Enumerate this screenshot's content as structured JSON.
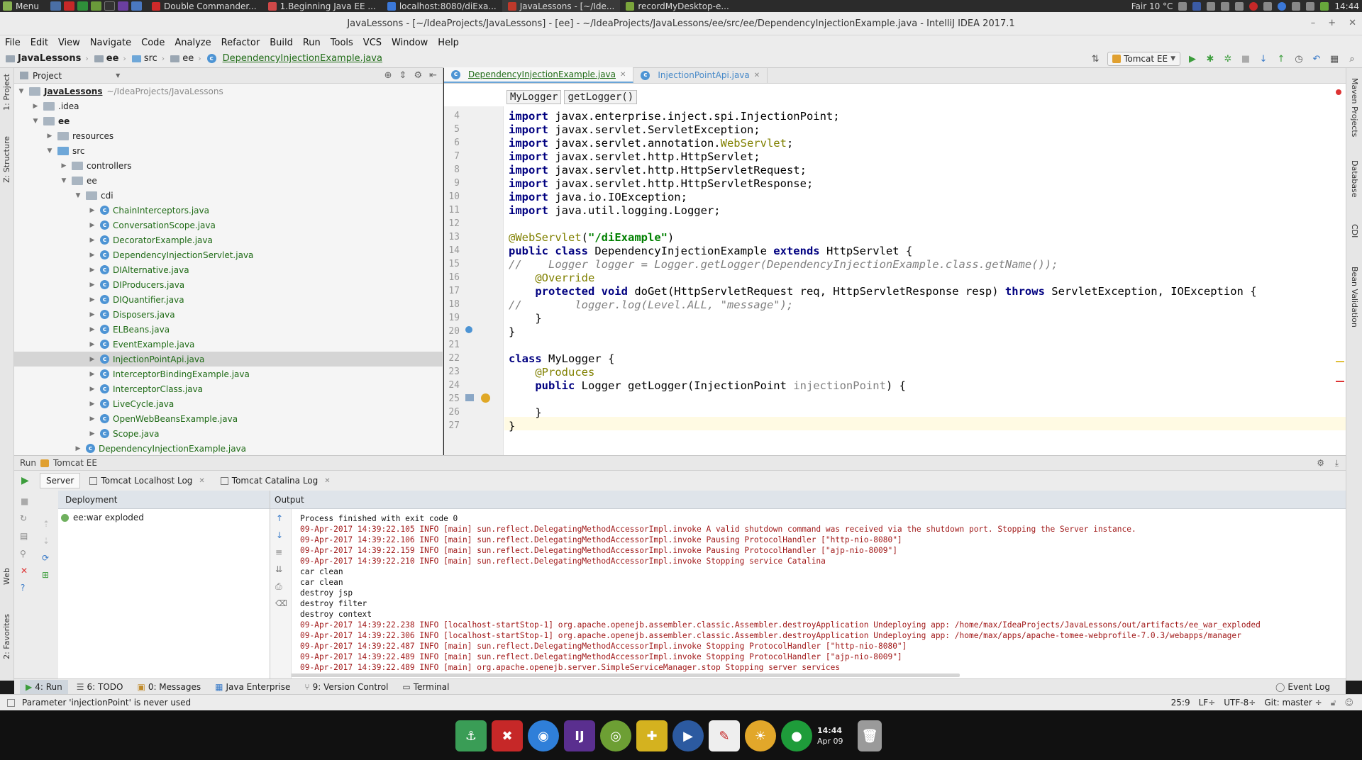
{
  "system": {
    "menu_label": "Menu",
    "tasks": [
      {
        "label": "Double Commander...",
        "color": "#cf2a2a"
      },
      {
        "label": "1.Beginning Java EE ...",
        "color": "#d04848"
      },
      {
        "label": "localhost:8080/diExa...",
        "color": "#3b78d8"
      },
      {
        "label": "JavaLessons - [~/Ide...",
        "color": "#c0392b"
      },
      {
        "label": "recordMyDesktop-e...",
        "color": "#7aa43b"
      }
    ],
    "weather": "Fair 10 °C",
    "clock": "14:44"
  },
  "window": {
    "title": "JavaLessons - [~/IdeaProjects/JavaLessons] - [ee] - ~/IdeaProjects/JavaLessons/ee/src/ee/DependencyInjectionExample.java - IntelliJ IDEA 2017.1"
  },
  "menubar": [
    "File",
    "Edit",
    "View",
    "Navigate",
    "Code",
    "Analyze",
    "Refactor",
    "Build",
    "Run",
    "Tools",
    "VCS",
    "Window",
    "Help"
  ],
  "navbar": {
    "crumbs": [
      "JavaLessons",
      "ee",
      "src",
      "ee",
      "DependencyInjectionExample.java"
    ],
    "run_config": "Tomcat EE"
  },
  "left_strip": [
    "1: Project",
    "Z: Structure",
    "Web",
    "2: Favorites"
  ],
  "right_strip": [
    "Maven Projects",
    "Database",
    "CDI",
    "Bean Validation"
  ],
  "project": {
    "header": "Project",
    "root_name": "JavaLessons",
    "root_path": "~/IdeaProjects/JavaLessons",
    "idea": ".idea",
    "ee": "ee",
    "resources": "resources",
    "src": "src",
    "controllers": "controllers",
    "ee_pkg": "ee",
    "cdi": "cdi",
    "files": [
      "ChainInterceptors.java",
      "ConversationScope.java",
      "DecoratorExample.java",
      "DependencyInjectionServlet.java",
      "DIAlternative.java",
      "DIProducers.java",
      "DIQuantifier.java",
      "Disposers.java",
      "ELBeans.java",
      "EventExample.java",
      "InjectionPointApi.java",
      "InterceptorBindingExample.java",
      "InterceptorClass.java",
      "LiveCycle.java",
      "OpenWebBeansExample.java",
      "Scope.java"
    ],
    "last_file": "DependencyInjectionExample.java"
  },
  "editor": {
    "tabs": [
      "DependencyInjectionExample.java",
      "InjectionPointApi.java"
    ],
    "crumbs": [
      "MyLogger",
      "getLogger()"
    ],
    "line_numbers": [
      "4",
      "5",
      "6",
      "7",
      "8",
      "9",
      "10",
      "11",
      "12",
      "13",
      "14",
      "15",
      "16",
      "17",
      "18",
      "19",
      "20",
      "21",
      "22",
      "23",
      "24",
      "25",
      "26",
      "27"
    ]
  },
  "run": {
    "header_run": "Run",
    "header_config": "Tomcat EE",
    "tabs": [
      "Server",
      "Tomcat Localhost Log",
      "Tomcat Catalina Log"
    ],
    "deployment_header": "Deployment",
    "deployment_item": "ee:war exploded",
    "output_header": "Output",
    "output_lines": [
      "Process finished with exit code 0",
      "09-Apr-2017 14:39:22.105 INFO [main] sun.reflect.DelegatingMethodAccessorImpl.invoke A valid shutdown command was received via the shutdown port. Stopping the Server instance.",
      "09-Apr-2017 14:39:22.106 INFO [main] sun.reflect.DelegatingMethodAccessorImpl.invoke Pausing ProtocolHandler [\"http-nio-8080\"]",
      "09-Apr-2017 14:39:22.159 INFO [main] sun.reflect.DelegatingMethodAccessorImpl.invoke Pausing ProtocolHandler [\"ajp-nio-8009\"]",
      "09-Apr-2017 14:39:22.210 INFO [main] sun.reflect.DelegatingMethodAccessorImpl.invoke Stopping service Catalina",
      "car clean",
      "car clean",
      "destroy jsp",
      "destroy filter",
      "destroy context",
      "09-Apr-2017 14:39:22.238 INFO [localhost-startStop-1] org.apache.openejb.assembler.classic.Assembler.destroyApplication Undeploying app: /home/max/IdeaProjects/JavaLessons/out/artifacts/ee_war_exploded",
      "09-Apr-2017 14:39:22.306 INFO [localhost-startStop-1] org.apache.openejb.assembler.classic.Assembler.destroyApplication Undeploying app: /home/max/apps/apache-tomee-webprofile-7.0.3/webapps/manager",
      "09-Apr-2017 14:39:22.487 INFO [main] sun.reflect.DelegatingMethodAccessorImpl.invoke Stopping ProtocolHandler [\"http-nio-8080\"]",
      "09-Apr-2017 14:39:22.489 INFO [main] sun.reflect.DelegatingMethodAccessorImpl.invoke Stopping ProtocolHandler [\"ajp-nio-8009\"]",
      "09-Apr-2017 14:39:22.489 INFO [main] org.apache.openejb.server.SimpleServiceManager.stop Stopping server services"
    ]
  },
  "bottom_tabs": [
    "4: Run",
    "6: TODO",
    "0: Messages",
    "Java Enterprise",
    "9: Version Control",
    "Terminal"
  ],
  "event_log": "Event Log",
  "status": {
    "message": "Parameter 'injectionPoint' is never used",
    "position": "25:9",
    "line_sep": "LF÷",
    "encoding": "UTF-8÷",
    "git": "Git: master ÷"
  },
  "dock": {
    "clock_time": "14:44",
    "clock_date": "Apr 09"
  }
}
